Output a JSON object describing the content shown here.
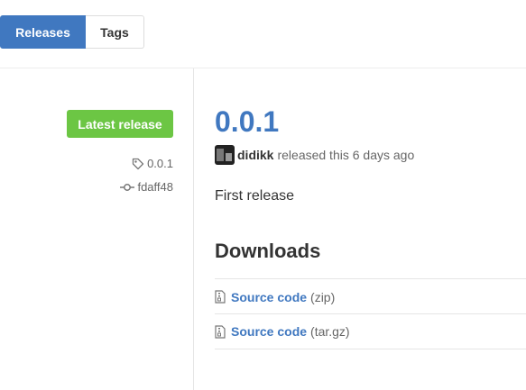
{
  "tabs": [
    {
      "label": "Releases",
      "active": true
    },
    {
      "label": "Tags",
      "active": false
    }
  ],
  "sidebar": {
    "badge": "Latest release",
    "tag": "0.0.1",
    "commit": "fdaff48",
    "icons": {
      "tag": "tag-icon",
      "commit": "git-commit-icon"
    }
  },
  "release": {
    "version": "0.0.1",
    "author": "didikk",
    "released_text": "released this 6 days ago",
    "body": "First release"
  },
  "downloads": {
    "heading": "Downloads",
    "items": [
      {
        "name": "Source code",
        "format": "(zip)",
        "icon": "file-zip-icon"
      },
      {
        "name": "Source code",
        "format": "(tar.gz)",
        "icon": "file-zip-icon"
      }
    ]
  },
  "colors": {
    "accent": "#4078c0",
    "latest_badge": "#6cc644",
    "text": "#333333",
    "muted": "#666666"
  }
}
